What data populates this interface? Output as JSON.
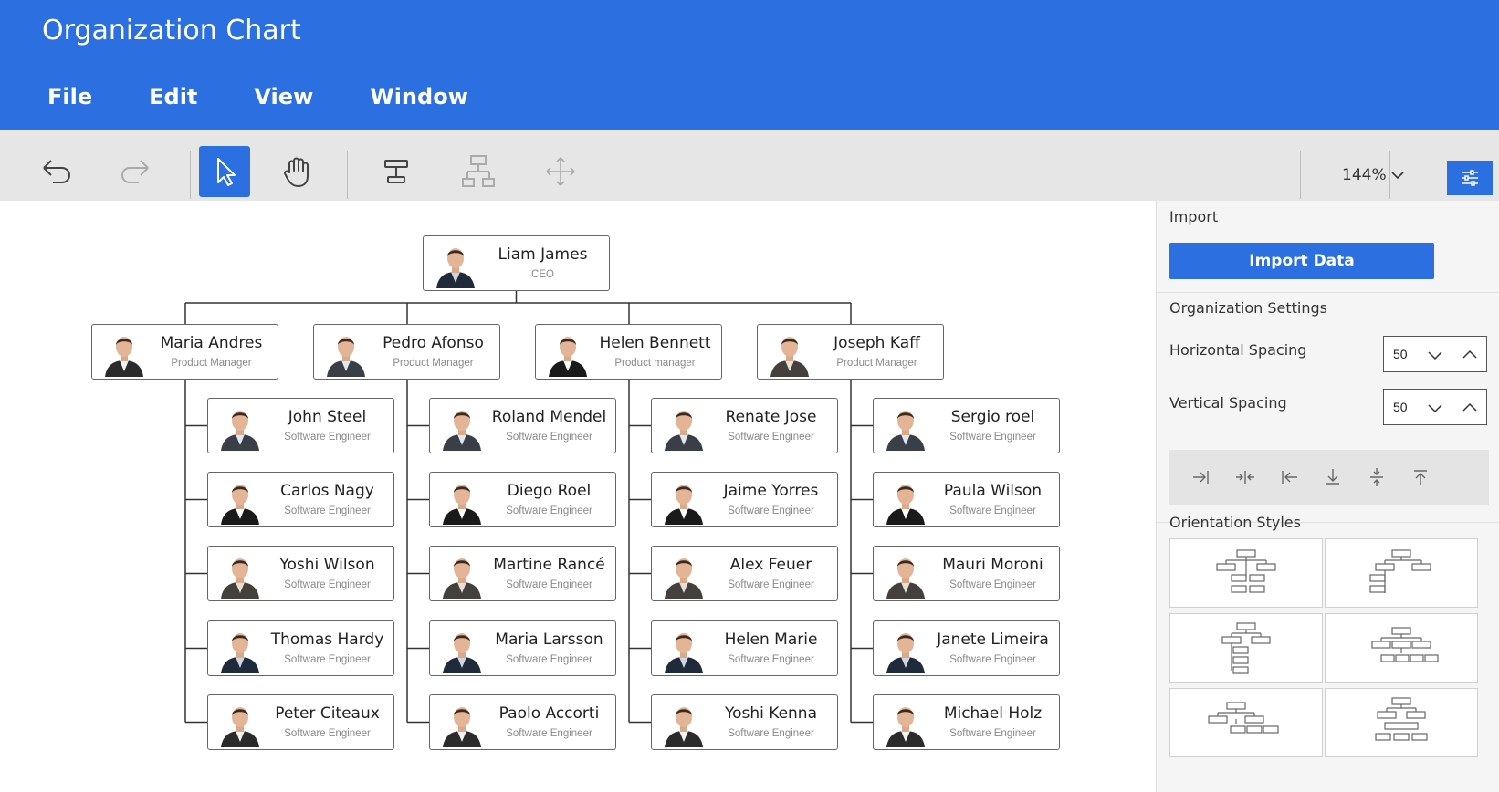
{
  "app": {
    "title": "Organization Chart"
  },
  "menu": {
    "items": [
      "File",
      "Edit",
      "View",
      "Window"
    ]
  },
  "toolbar": {
    "zoom": "144%"
  },
  "chart": {
    "root": {
      "name": "Liam James",
      "role": "CEO"
    },
    "managers": [
      {
        "name": "Maria Andres",
        "role": "Product Manager"
      },
      {
        "name": "Pedro Afonso",
        "role": "Product Manager"
      },
      {
        "name": "Helen Bennett",
        "role": "Product manager"
      },
      {
        "name": "Joseph Kaff",
        "role": "Product Manager"
      }
    ],
    "teams": [
      [
        {
          "name": "John Steel",
          "role": "Software Engineer"
        },
        {
          "name": "Carlos Nagy",
          "role": "Software Engineer"
        },
        {
          "name": "Yoshi Wilson",
          "role": "Software Engineer"
        },
        {
          "name": "Thomas Hardy",
          "role": "Software Engineer"
        },
        {
          "name": "Peter Citeaux",
          "role": "Software Engineer"
        }
      ],
      [
        {
          "name": "Roland Mendel",
          "role": "Software Engineer"
        },
        {
          "name": "Diego Roel",
          "role": "Software Engineer"
        },
        {
          "name": "Martine Rancé",
          "role": "Software Engineer"
        },
        {
          "name": "Maria Larsson",
          "role": "Software Engineer"
        },
        {
          "name": "Paolo Accorti",
          "role": "Software Engineer"
        }
      ],
      [
        {
          "name": "Renate Jose",
          "role": "Software Engineer"
        },
        {
          "name": "Jaime Yorres",
          "role": "Software Engineer"
        },
        {
          "name": "Alex Feuer",
          "role": "Software Engineer"
        },
        {
          "name": "Helen Marie",
          "role": "Software Engineer"
        },
        {
          "name": "Yoshi Kenna",
          "role": "Software Engineer"
        }
      ],
      [
        {
          "name": "Sergio roel",
          "role": "Software Engineer"
        },
        {
          "name": "Paula Wilson",
          "role": "Software Engineer"
        },
        {
          "name": "Mauri Moroni",
          "role": "Software Engineer"
        },
        {
          "name": "Janete Limeira",
          "role": "Software Engineer"
        },
        {
          "name": "Michael Holz",
          "role": "Software Engineer"
        }
      ]
    ]
  },
  "panel": {
    "import_label": "Import",
    "import_button": "Import Data",
    "org_settings_label": "Organization Settings",
    "horizontal_label": "Horizontal Spacing",
    "horizontal_value": "50",
    "vertical_label": "Vertical Spacing",
    "vertical_value": "50",
    "orientation_label": "Orientation Styles"
  },
  "colors": {
    "accent": "#2b6fe0",
    "toolbar": "#e6e6e6",
    "panel": "#f5f5f5"
  },
  "icons": {
    "toolbar": [
      "undo-icon",
      "redo-icon",
      "pointer-icon",
      "pan-hand-icon",
      "add-child-icon",
      "add-sibling-icon",
      "move-icon",
      "chevron-down-icon",
      "settings-sliders-icon"
    ],
    "align": [
      "align-right-icon",
      "align-center-horizontal-icon",
      "align-left-icon",
      "align-bottom-icon",
      "align-center-vertical-icon",
      "align-top-icon"
    ]
  }
}
